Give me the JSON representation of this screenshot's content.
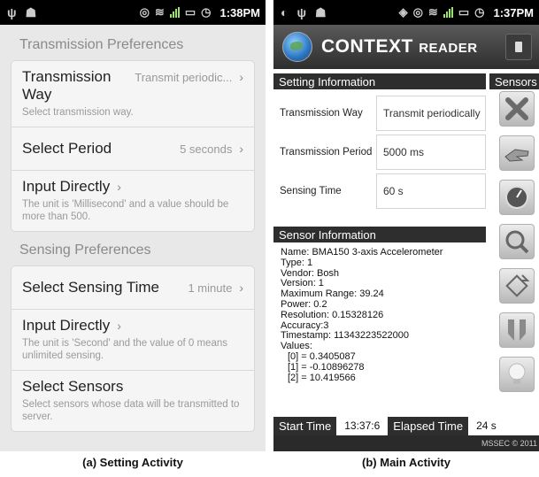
{
  "left": {
    "status": {
      "time": "1:38PM"
    },
    "transmission_header": "Transmission Preferences",
    "transmission_items": [
      {
        "title": "Transmission Way",
        "value": "Transmit periodic...",
        "desc": "Select transmission way."
      },
      {
        "title": "Select Period",
        "value": "5 seconds",
        "desc": ""
      },
      {
        "title": "Input Directly",
        "value": "",
        "desc": "The unit is 'Millisecond' and a value should be more than 500."
      }
    ],
    "sensing_header": "Sensing Preferences",
    "sensing_items": [
      {
        "title": "Select Sensing Time",
        "value": "1 minute",
        "desc": ""
      },
      {
        "title": "Input Directly",
        "value": "",
        "desc": "The unit is 'Second' and the value of 0 means unlimited sensing."
      },
      {
        "title": "Select Sensors",
        "value": "",
        "desc": "Select sensors whose data will be transmitted to server."
      }
    ],
    "caption": "(a) Setting Activity"
  },
  "right": {
    "status": {
      "time": "1:37PM"
    },
    "app_title": "CONTEXT",
    "app_title_small": "READER",
    "setting_info_label": "Setting Information",
    "sensors_label": "Sensors",
    "settings": [
      {
        "label": "Transmission Way",
        "value": "Transmit periodically"
      },
      {
        "label": "Transmission Period",
        "value": "5000 ms"
      },
      {
        "label": "Sensing Time",
        "value": "60 s"
      }
    ],
    "sensor_info_label": "Sensor Information",
    "sensor_lines": [
      "Name: BMA150 3-axis Accelerometer",
      "Type:  1",
      "Vendor:  Bosh",
      "Version:  1",
      "Maximum Range:   39.24",
      "Power: 0.2",
      "Resolution:  0.15328126",
      "Accuracy:3",
      "Timestamp: 11343223522000",
      "Values:"
    ],
    "sensor_values": [
      "[0] = 0.3405087",
      "[1] = -0.10896278",
      "[2] = 10.419566"
    ],
    "sensor_icons": [
      "close-x-icon",
      "hand-icon",
      "compass-icon",
      "magnifier-icon",
      "rotate-icon",
      "proximity-icon",
      "light-bulb-icon"
    ],
    "start_time_label": "Start Time",
    "start_time_value": "13:37:6",
    "elapsed_label": "Elapsed Time",
    "elapsed_value": "24 s",
    "footer": "MSSEC © 2011",
    "caption": "(b) Main Activity"
  }
}
